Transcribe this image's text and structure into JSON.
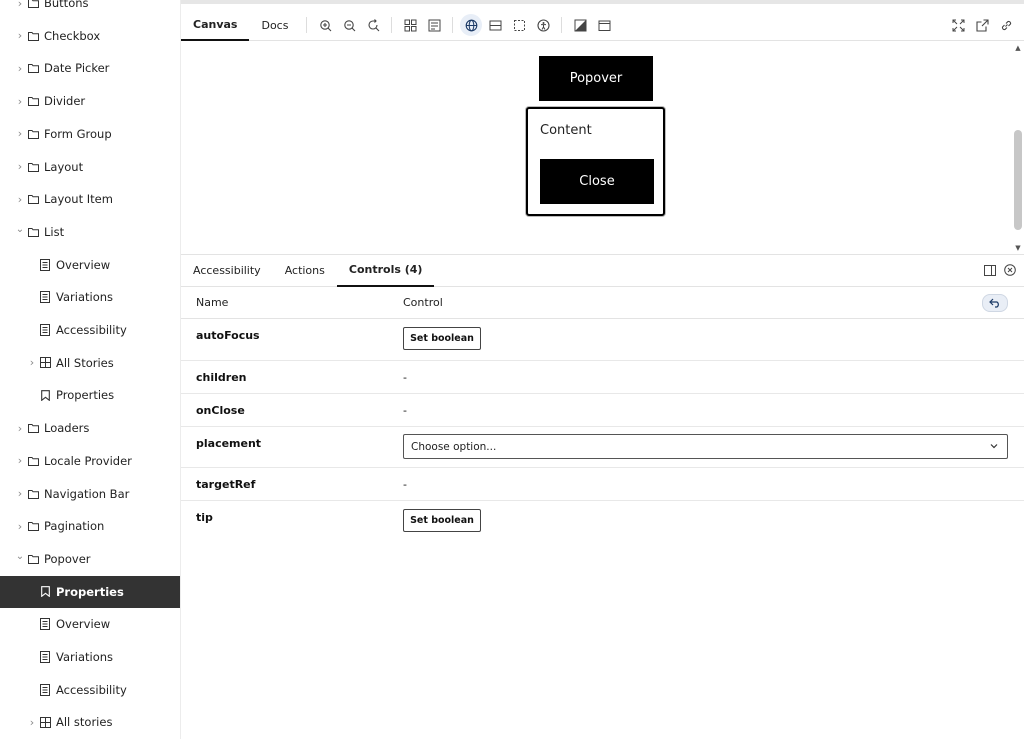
{
  "sidebar": {
    "items": [
      {
        "label": "Buttons",
        "kind": "folder",
        "level": 0,
        "caret": "right"
      },
      {
        "label": "Checkbox",
        "kind": "folder",
        "level": 0,
        "caret": "right"
      },
      {
        "label": "Date Picker",
        "kind": "folder",
        "level": 0,
        "caret": "right"
      },
      {
        "label": "Divider",
        "kind": "folder",
        "level": 0,
        "caret": "right"
      },
      {
        "label": "Form Group",
        "kind": "folder",
        "level": 0,
        "caret": "right"
      },
      {
        "label": "Layout",
        "kind": "folder",
        "level": 0,
        "caret": "right"
      },
      {
        "label": "Layout Item",
        "kind": "folder",
        "level": 0,
        "caret": "right"
      },
      {
        "label": "List",
        "kind": "folder",
        "level": 0,
        "caret": "down"
      },
      {
        "label": "Overview",
        "kind": "doc",
        "level": 1
      },
      {
        "label": "Variations",
        "kind": "doc",
        "level": 1
      },
      {
        "label": "Accessibility",
        "kind": "doc",
        "level": 1
      },
      {
        "label": "All Stories",
        "kind": "grid",
        "level": 1,
        "caret": "right"
      },
      {
        "label": "Properties",
        "kind": "bookmark",
        "level": 1
      },
      {
        "label": "Loaders",
        "kind": "folder",
        "level": 0,
        "caret": "right"
      },
      {
        "label": "Locale Provider",
        "kind": "folder",
        "level": 0,
        "caret": "right"
      },
      {
        "label": "Navigation Bar",
        "kind": "folder",
        "level": 0,
        "caret": "right"
      },
      {
        "label": "Pagination",
        "kind": "folder",
        "level": 0,
        "caret": "right"
      },
      {
        "label": "Popover",
        "kind": "folder",
        "level": 0,
        "caret": "down"
      },
      {
        "label": "Properties",
        "kind": "bookmark",
        "level": 1,
        "selected": true
      },
      {
        "label": "Overview",
        "kind": "doc",
        "level": 1
      },
      {
        "label": "Variations",
        "kind": "doc",
        "level": 1
      },
      {
        "label": "Accessibility",
        "kind": "doc",
        "level": 1
      },
      {
        "label": "All stories",
        "kind": "grid",
        "level": 1,
        "caret": "right"
      }
    ]
  },
  "toolbar": {
    "tabs": [
      {
        "label": "Canvas",
        "active": true
      },
      {
        "label": "Docs",
        "active": false
      }
    ],
    "tools": [
      "zoom-in-icon",
      "zoom-out-icon",
      "zoom-reset-icon",
      "grid-icon",
      "background-icon",
      "globe-icon",
      "measure-icon",
      "outline-icon",
      "accessibility-icon",
      "contrast-icon",
      "viewport-icon"
    ],
    "right_tools": [
      "fullscreen-icon",
      "open-new-tab-icon",
      "copy-link-icon"
    ]
  },
  "canvas": {
    "trigger_label": "Popover",
    "popover_content": "Content",
    "close_label": "Close"
  },
  "addons": {
    "tabs": [
      {
        "label": "Accessibility",
        "active": false
      },
      {
        "label": "Actions",
        "active": false
      },
      {
        "label": "Controls (4)",
        "active": true
      }
    ]
  },
  "controls": {
    "header_name": "Name",
    "header_control": "Control",
    "rows": [
      {
        "name": "autoFocus",
        "control": "boolean",
        "button_label": "Set boolean"
      },
      {
        "name": "children",
        "control": "none",
        "value": "-"
      },
      {
        "name": "onClose",
        "control": "none",
        "value": "-"
      },
      {
        "name": "placement",
        "control": "select",
        "value": "Choose option..."
      },
      {
        "name": "targetRef",
        "control": "none",
        "value": "-"
      },
      {
        "name": "tip",
        "control": "boolean",
        "button_label": "Set boolean"
      }
    ]
  },
  "colors": {
    "selected_bg": "#333333",
    "primary_button": "#000000",
    "accent_light": "#e8eef7"
  }
}
